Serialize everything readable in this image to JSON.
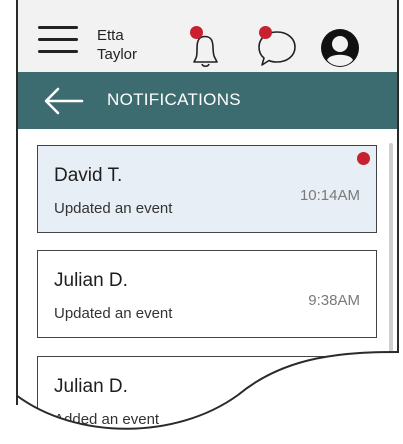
{
  "user": {
    "first_name": "Etta",
    "last_name": "Taylor"
  },
  "icons": {
    "menu": "hamburger-menu-icon",
    "bell": "bell-icon",
    "chat": "chat-bubble-icon",
    "profile": "user-profile-icon",
    "back": "back-arrow-icon"
  },
  "colors": {
    "header_bg": "#3d6c70",
    "badge": "#c8202e",
    "unread_bg": "#e7eef5"
  },
  "header": {
    "title": "NOTIFICATIONS"
  },
  "notifications": [
    {
      "name": "David T.",
      "action": "Updated an event",
      "time": "10:14AM",
      "unread": true
    },
    {
      "name": "Julian D.",
      "action": "Updated an event",
      "time": "9:38AM",
      "unread": false
    },
    {
      "name": "Julian D.",
      "action": "Added an event",
      "time": "",
      "unread": false
    }
  ]
}
